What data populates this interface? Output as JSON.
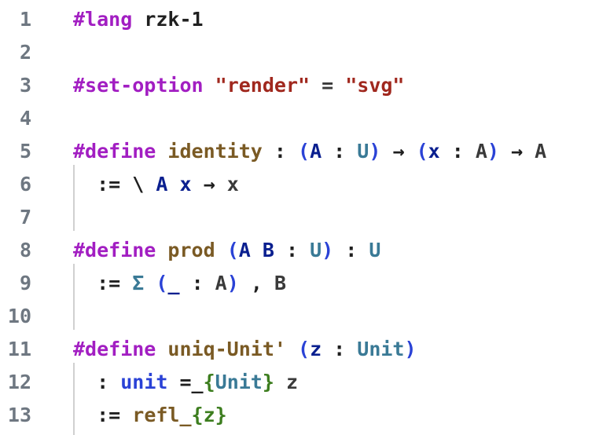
{
  "editor": {
    "lines": [
      {
        "num": "1",
        "tokens": [
          {
            "t": "#lang",
            "c": "kw"
          },
          {
            "t": " rzk-1",
            "c": "plain"
          }
        ]
      },
      {
        "num": "2",
        "tokens": []
      },
      {
        "num": "3",
        "tokens": [
          {
            "t": "#set-option",
            "c": "kw"
          },
          {
            "t": " ",
            "c": "plain"
          },
          {
            "t": "\"render\"",
            "c": "str"
          },
          {
            "t": " = ",
            "c": "op"
          },
          {
            "t": "\"svg\"",
            "c": "str"
          }
        ]
      },
      {
        "num": "4",
        "tokens": []
      },
      {
        "num": "5",
        "tokens": [
          {
            "t": "#define",
            "c": "kw"
          },
          {
            "t": " ",
            "c": "plain"
          },
          {
            "t": "identity",
            "c": "def"
          },
          {
            "t": " : ",
            "c": "sym"
          },
          {
            "t": "(",
            "c": "bpar"
          },
          {
            "t": "A",
            "c": "var"
          },
          {
            "t": " : ",
            "c": "sym"
          },
          {
            "t": "U",
            "c": "type"
          },
          {
            "t": ")",
            "c": "bpar"
          },
          {
            "t": " → ",
            "c": "sym"
          },
          {
            "t": "(",
            "c": "bpar"
          },
          {
            "t": "x",
            "c": "var"
          },
          {
            "t": " : ",
            "c": "sym"
          },
          {
            "t": "A",
            "c": "op"
          },
          {
            "t": ")",
            "c": "bpar"
          },
          {
            "t": " → ",
            "c": "sym"
          },
          {
            "t": "A",
            "c": "op"
          }
        ]
      },
      {
        "num": "6",
        "tokens": [
          {
            "t": "  := \\ ",
            "c": "sym"
          },
          {
            "t": "A",
            "c": "var"
          },
          {
            "t": " ",
            "c": "plain"
          },
          {
            "t": "x",
            "c": "var"
          },
          {
            "t": " → ",
            "c": "sym"
          },
          {
            "t": "x",
            "c": "op"
          }
        ]
      },
      {
        "num": "7",
        "tokens": []
      },
      {
        "num": "8",
        "tokens": [
          {
            "t": "#define",
            "c": "kw"
          },
          {
            "t": " ",
            "c": "plain"
          },
          {
            "t": "prod",
            "c": "def"
          },
          {
            "t": " ",
            "c": "plain"
          },
          {
            "t": "(",
            "c": "bpar"
          },
          {
            "t": "A",
            "c": "var"
          },
          {
            "t": " ",
            "c": "plain"
          },
          {
            "t": "B",
            "c": "var"
          },
          {
            "t": " : ",
            "c": "sym"
          },
          {
            "t": "U",
            "c": "type"
          },
          {
            "t": ")",
            "c": "bpar"
          },
          {
            "t": " : ",
            "c": "sym"
          },
          {
            "t": "U",
            "c": "type"
          }
        ]
      },
      {
        "num": "9",
        "tokens": [
          {
            "t": "  := ",
            "c": "sym"
          },
          {
            "t": "Σ",
            "c": "type"
          },
          {
            "t": " ",
            "c": "plain"
          },
          {
            "t": "(",
            "c": "bpar"
          },
          {
            "t": "_",
            "c": "var"
          },
          {
            "t": " : ",
            "c": "sym"
          },
          {
            "t": "A",
            "c": "op"
          },
          {
            "t": ")",
            "c": "bpar"
          },
          {
            "t": " , ",
            "c": "sym"
          },
          {
            "t": "B",
            "c": "op"
          }
        ]
      },
      {
        "num": "10",
        "tokens": []
      },
      {
        "num": "11",
        "tokens": [
          {
            "t": "#define",
            "c": "kw"
          },
          {
            "t": " ",
            "c": "plain"
          },
          {
            "t": "uniq-Unit'",
            "c": "def"
          },
          {
            "t": " ",
            "c": "plain"
          },
          {
            "t": "(",
            "c": "bpar"
          },
          {
            "t": "z",
            "c": "var"
          },
          {
            "t": " : ",
            "c": "sym"
          },
          {
            "t": "Unit",
            "c": "type"
          },
          {
            "t": ")",
            "c": "bpar"
          }
        ]
      },
      {
        "num": "12",
        "tokens": [
          {
            "t": "  : ",
            "c": "sym"
          },
          {
            "t": "unit",
            "c": "bpar"
          },
          {
            "t": " =_",
            "c": "sym"
          },
          {
            "t": "{",
            "c": "grn"
          },
          {
            "t": "Unit",
            "c": "type"
          },
          {
            "t": "}",
            "c": "grn"
          },
          {
            "t": " z",
            "c": "op"
          }
        ]
      },
      {
        "num": "13",
        "tokens": [
          {
            "t": "  := ",
            "c": "sym"
          },
          {
            "t": "refl_",
            "c": "def"
          },
          {
            "t": "{",
            "c": "grn"
          },
          {
            "t": "z",
            "c": "grn"
          },
          {
            "t": "}",
            "c": "grn"
          }
        ]
      }
    ]
  }
}
